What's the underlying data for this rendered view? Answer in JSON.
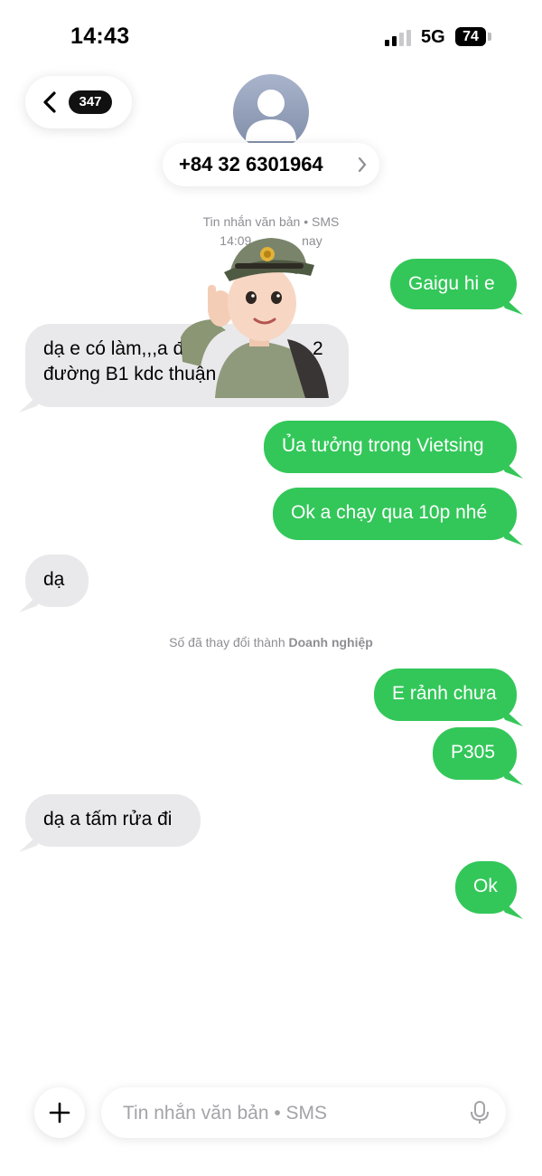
{
  "status_bar": {
    "time": "14:43",
    "network": "5G",
    "battery": "74"
  },
  "header": {
    "unread_count": "347",
    "contact": "+84 32 6301964"
  },
  "conversation": {
    "info_label": "Tin nhắn văn bản • SMS",
    "info_time_prefix": "14:09",
    "info_time_suffix": "nay",
    "change_notice_prefix": "Số đã thay đổi thành ",
    "change_notice_bold": "Doanh nghiệp",
    "messages": [
      {
        "text": "Gaigu hi e",
        "direction": "outgoing"
      },
      {
        "text": "dạ e có làm,,,a đến",
        "direction": "incoming"
      },
      {
        "text_line2": "đường B1 kdc thuận",
        "direction": "incoming"
      },
      {
        "text": "Ủa tưởng trong Vietsing",
        "direction": "outgoing"
      },
      {
        "text": "Ok a chạy qua 10p nhé",
        "direction": "outgoing"
      },
      {
        "text": "dạ",
        "direction": "incoming"
      },
      {
        "text": "E rảnh chưa",
        "direction": "outgoing"
      },
      {
        "text": "P305",
        "direction": "outgoing"
      },
      {
        "text": "dạ a tấm rửa đi",
        "direction": "incoming"
      },
      {
        "text": "Ok",
        "direction": "outgoing"
      }
    ],
    "partial_fragment": "2"
  },
  "compose": {
    "placeholder": "Tin nhắn văn bản • SMS"
  },
  "colors": {
    "outgoing_bubble": "#33c759",
    "incoming_bubble": "#e9e9eb",
    "meta_text": "#8e8e93"
  },
  "icons": [
    "back-chevron-icon",
    "person-icon",
    "chevron-right-icon",
    "plus-icon",
    "microphone-icon",
    "sticker-memoji"
  ]
}
